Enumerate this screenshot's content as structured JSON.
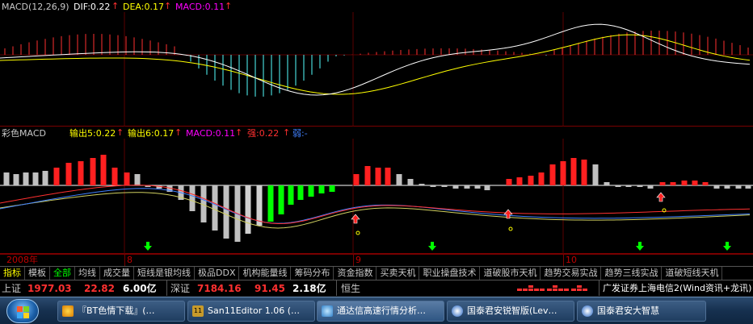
{
  "macd_pane": {
    "title": "MACD(12,26,9)",
    "dif_label": "DIF:0.22",
    "dea_label": "DEA:0.17",
    "macd_label": "MACD:0.11",
    "up_arrow": "↑"
  },
  "color_macd_pane": {
    "title": "彩色MACD",
    "out5_label": "输出5:0.22",
    "out6_label": "输出6:0.17",
    "macd_label": "MACD:0.11",
    "strong_label": "强:0.22",
    "weak_label": "弱:-",
    "up_arrow": "↑"
  },
  "time_axis": {
    "year_label": "2008年",
    "labels": [
      "8",
      "9",
      "10"
    ]
  },
  "tabs": [
    "指标",
    "模板",
    "全部",
    "均线",
    "成交量",
    "短线是银均线",
    "极品DDX",
    "机构能量线",
    "筹码分布",
    "资金指数",
    "买卖天机",
    "职业操盘技术",
    "道破股市天机",
    "趋势交易实战",
    "趋势三线实战",
    "道破短线天机"
  ],
  "quotes": {
    "sh_name": "上证",
    "sh_index": "1977.03",
    "sh_change": "22.82",
    "sh_amount": "6.00亿",
    "sz_name": "深证",
    "sz_index": "7184.16",
    "sz_change": "91.45",
    "sz_amount": "2.18亿",
    "hs_name": "恒生",
    "news": "广发证券上海电信2(Wind资讯+龙讯)"
  },
  "taskbar": {
    "items": [
      "『BT色情下载』(…",
      "San11Editor 1.06 (…",
      "通达信高速行情分析…",
      "国泰君安锐智版(Lev…",
      "国泰君安大智慧"
    ],
    "icon_names": [
      "browser-icon",
      "editor-icon",
      "gear-icon",
      "shield-icon",
      "shield-icon"
    ]
  },
  "colors": {
    "up_red": "#ff3030",
    "down_cyan": "#54ffff",
    "green": "#00ff00",
    "dif_white": "#ffffff",
    "dea_yellow": "#ffff00",
    "magenta": "#ff00ff",
    "blue": "#4080ff"
  }
}
